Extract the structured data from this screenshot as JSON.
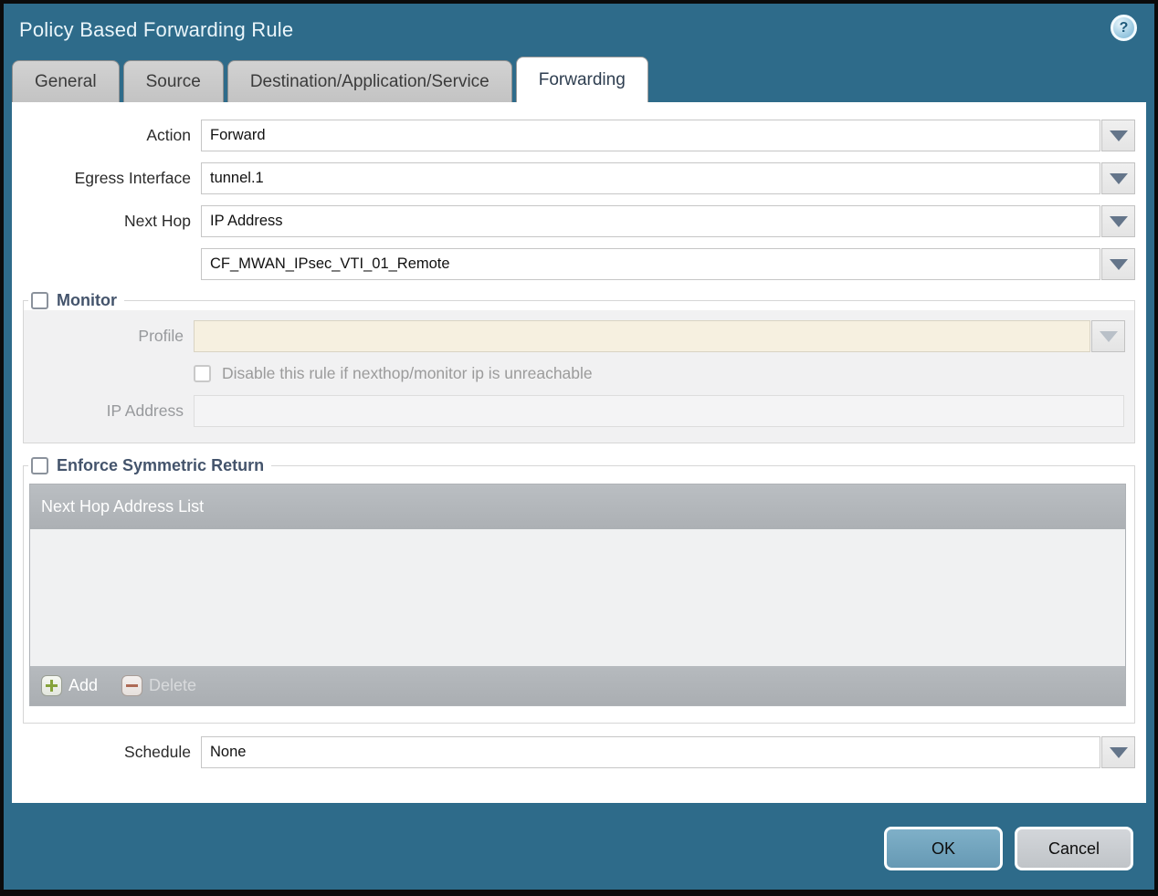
{
  "dialog": {
    "title": "Policy Based Forwarding Rule",
    "help_glyph": "?"
  },
  "tabs": [
    {
      "label": "General",
      "active": false
    },
    {
      "label": "Source",
      "active": false
    },
    {
      "label": "Destination/Application/Service",
      "active": false
    },
    {
      "label": "Forwarding",
      "active": true
    }
  ],
  "form": {
    "action": {
      "label": "Action",
      "value": "Forward"
    },
    "egress_interface": {
      "label": "Egress Interface",
      "value": "tunnel.1"
    },
    "next_hop": {
      "label": "Next Hop",
      "value": "IP Address"
    },
    "next_hop_address": {
      "value": "CF_MWAN_IPsec_VTI_01_Remote"
    },
    "schedule": {
      "label": "Schedule",
      "value": "None"
    }
  },
  "monitor": {
    "title": "Monitor",
    "checked": false,
    "profile": {
      "label": "Profile",
      "value": ""
    },
    "disable_rule_checkbox": {
      "label": "Disable this rule if nexthop/monitor ip is unreachable",
      "checked": false
    },
    "ip_address": {
      "label": "IP Address",
      "value": ""
    }
  },
  "symmetric_return": {
    "title": "Enforce Symmetric Return",
    "checked": false,
    "table": {
      "header": "Next Hop Address List",
      "rows": [],
      "add_label": "Add",
      "delete_label": "Delete",
      "delete_enabled": false
    }
  },
  "footer": {
    "ok_label": "OK",
    "cancel_label": "Cancel"
  },
  "colors": {
    "chrome_teal": "#2e6b8a",
    "active_tab_bg": "#ffffff",
    "inactive_tab_bg": "#c9c9c9",
    "section_title": "#44546c",
    "disabled_field_beige": "#f6f0e0",
    "table_gray": "#b2b6ba",
    "ok_button": "#72a6c0",
    "cancel_button": "#caced2",
    "add_icon_green": "#86a33b",
    "delete_icon_red": "#ad6a55"
  }
}
